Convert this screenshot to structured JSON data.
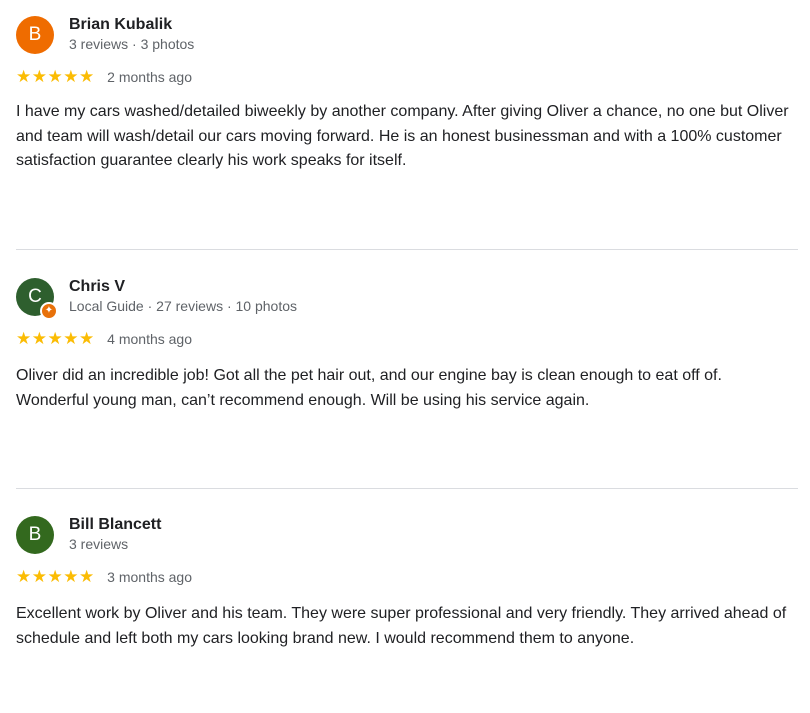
{
  "colors": {
    "star": "#fbbc04",
    "avatar_orange": "#ef6c00",
    "avatar_green_dark": "#2e5f2e",
    "avatar_green": "#33691e",
    "local_guide_badge": "#e8710a"
  },
  "reviews": [
    {
      "initial": "B",
      "name": "Brian Kubalik",
      "meta": "3 reviews · 3 photos",
      "stars": "★★★★★",
      "rating": 5,
      "date": "2 months ago",
      "text": "I have my cars washed/detailed biweekly by another company. After giving Oliver a chance, no one but Oliver and team will wash/detail our cars moving forward. He is an honest businessman and with a 100% customer satisfaction guarantee clearly his work speaks for itself."
    },
    {
      "initial": "C",
      "name": "Chris V",
      "meta": "Local Guide · 27 reviews · 10 photos",
      "badge_icon": "local-guide-badge-icon",
      "stars": "★★★★★",
      "rating": 5,
      "date": "4 months ago",
      "text": "Oliver did an incredible job! Got all the pet hair out, and our engine bay is clean enough to eat off of. Wonderful young man, can’t recommend enough. Will be using his service again."
    },
    {
      "initial": "B",
      "name": "Bill Blancett",
      "meta": "3 reviews",
      "stars": "★★★★★",
      "rating": 5,
      "date": "3 months ago",
      "text": "Excellent work by Oliver and his team. They were super professional and very friendly. They arrived ahead of schedule and left both my cars looking brand new. I would recommend them to anyone."
    }
  ]
}
